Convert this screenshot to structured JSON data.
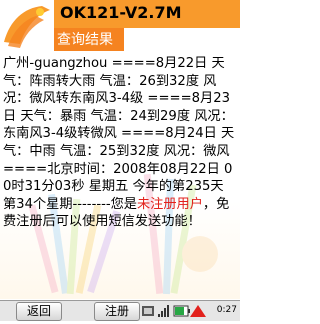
{
  "header": {
    "app_title": "OK121-V2.7M",
    "subtitle": "查询结果"
  },
  "content": {
    "main_text": "广州-guangzhou ====8月22日 天气：阵雨转大雨 气温：26到32度 风况：微风转东南风3-4级 ====8月23日 天气：暴雨 气温：24到29度 风况：东南风3-4级转微风 ====8月24日 天气：中雨 气温：25到32度 风况：微风 ====北京时间：2008年08月22日 00时31分03秒 星期五 今年的第235天 第34个星期--------",
    "notice_prefix": "您是",
    "notice_highlight": "未注册用户",
    "notice_suffix": "，免费注册后可以使用短信发送功能！"
  },
  "softkeys": {
    "left": "返回",
    "right": "注册"
  },
  "status": {
    "time": "0:27"
  },
  "colors": {
    "title_bar": "#f89a2c",
    "subtitle_bar": "#f58320",
    "highlight": "#e2211c"
  }
}
